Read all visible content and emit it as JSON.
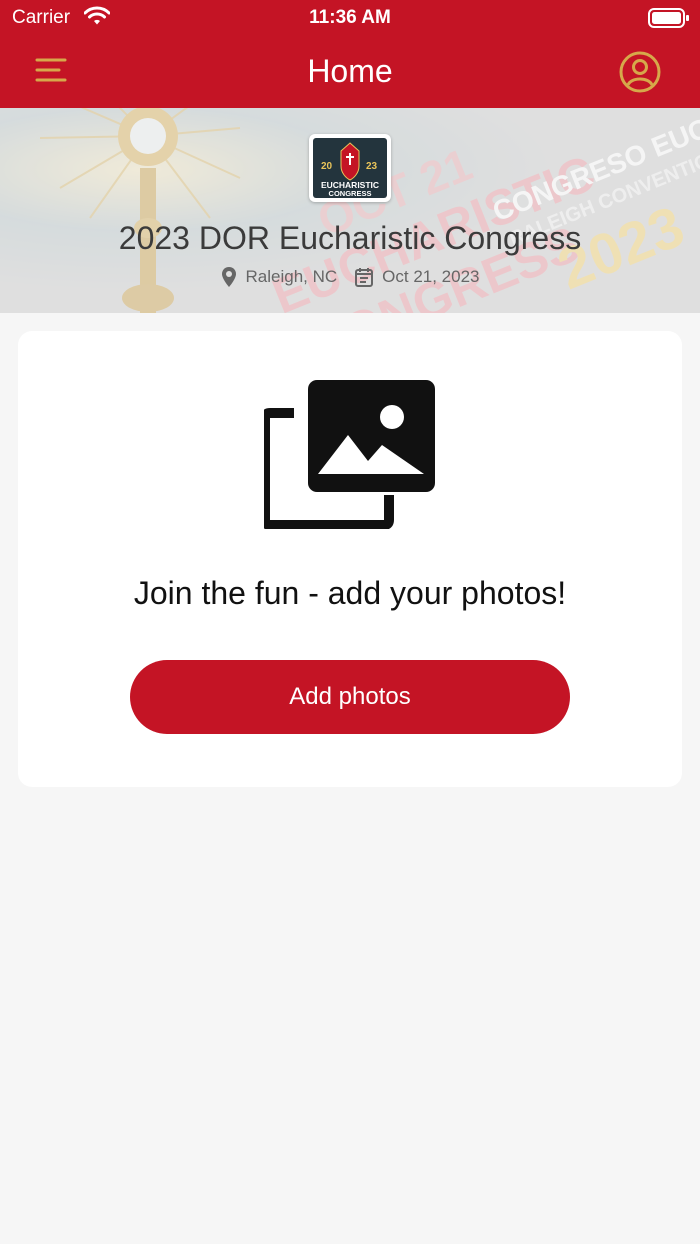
{
  "status_bar": {
    "carrier": "Carrier",
    "time": "11:36 AM"
  },
  "nav": {
    "title": "Home",
    "menu_icon": "hamburger-icon",
    "profile_icon": "user-circle-icon"
  },
  "event": {
    "logo_year_left": "20",
    "logo_year_right": "23",
    "logo_line1": "EUCHARISTIC",
    "logo_line2": "CONGRESS",
    "title": "2023 DOR Eucharistic Congress",
    "location": "Raleigh, NC",
    "date": "Oct 21, 2023",
    "banner_text": [
      "OCT 21",
      "EUCHARISTIC",
      "CONGRESS",
      "CONGRESO EUCARIS",
      "RALEIGH CONVENTION CENTE",
      "2023"
    ]
  },
  "upload_card": {
    "message": "Join the fun - add your photos!",
    "button_label": "Add photos",
    "icon": "photo-library-icon"
  },
  "colors": {
    "brand": "#c41425",
    "accent_gold": "#d6a84a",
    "background": "#f6f6f6"
  }
}
